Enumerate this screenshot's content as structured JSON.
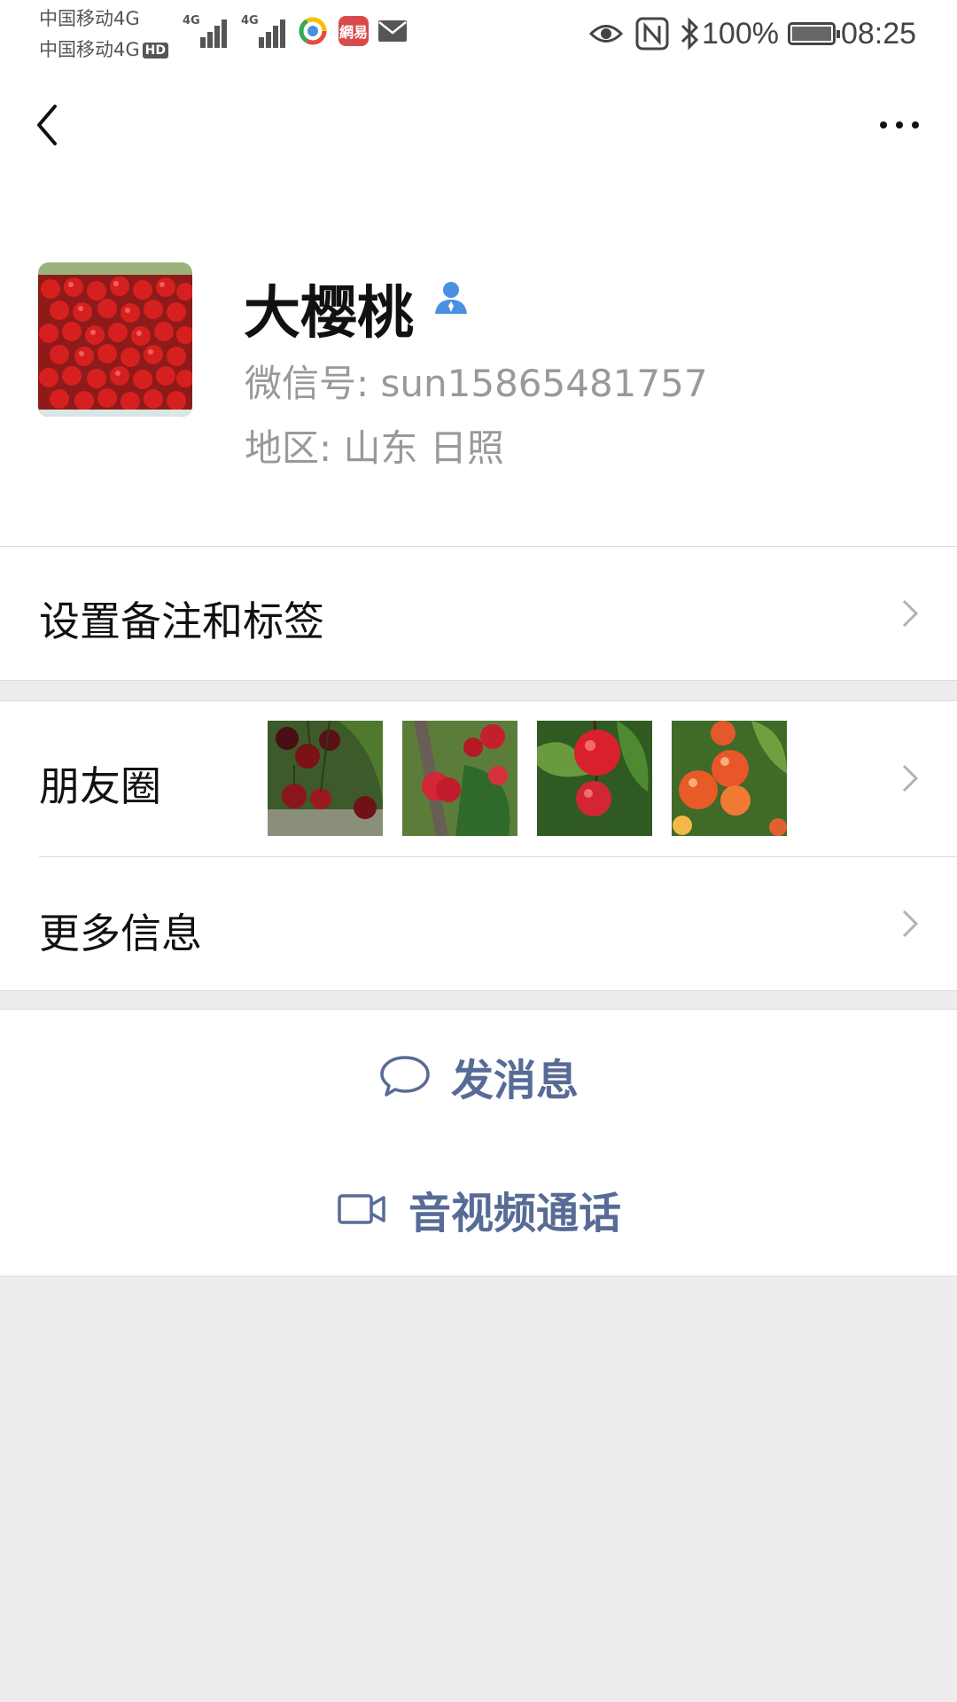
{
  "status_bar": {
    "carrier_1": "中国移动4G",
    "carrier_2": "中国移动4G",
    "hd_badge": "HD",
    "signal_tag_1": "4G",
    "signal_tag_2": "4G",
    "news_app_label": "網易",
    "battery_percent": "100%",
    "time": "08:25",
    "icons": [
      "eye-icon",
      "nfc-icon",
      "bluetooth-icon",
      "battery-icon",
      "mail-icon"
    ]
  },
  "nav": {
    "back_icon": "chevron-left-icon",
    "more_icon": "more-dots-icon"
  },
  "profile": {
    "name": "大樱桃",
    "wechat_id": "微信号: sun15865481757",
    "region": "地区: 山东  日照",
    "verified_icon": "person-icon",
    "accent_color": "#4a90e2"
  },
  "cells": {
    "remark_label": "设置备注和标签",
    "moments_label": "朋友圈",
    "more_info_label": "更多信息"
  },
  "actions": {
    "message_label": "发消息",
    "call_label": "音视频通话",
    "link_color": "#576b95"
  }
}
